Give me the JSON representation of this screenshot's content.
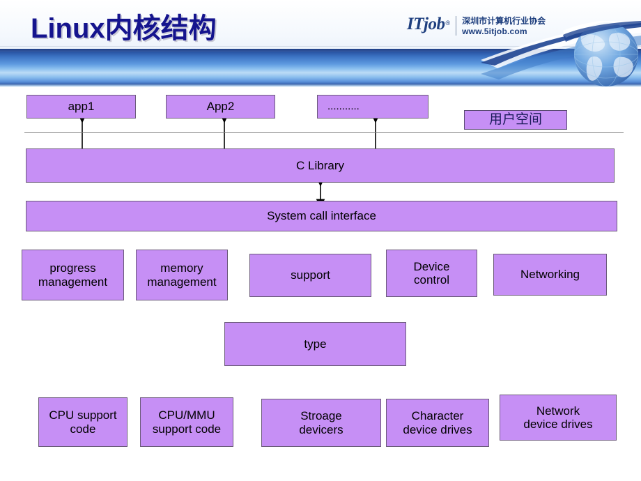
{
  "header": {
    "title": "Linux内核结构",
    "brand": {
      "name": "ITjob",
      "registered": "®",
      "association": "深圳市计算机行业协会",
      "url": "www.5itjob.com"
    }
  },
  "colors": {
    "box_fill": "#C68FF5",
    "box_border": "#6B5A7A",
    "title": "#15148E",
    "brand": "#1B3C7C",
    "divider": "#808080",
    "arrow": "#000000"
  },
  "diagram": {
    "title": "Linux kernel structure layers",
    "user_space_label": "用户空间",
    "row_apps": [
      {
        "label": "app1"
      },
      {
        "label": "App2"
      },
      {
        "label": "..........."
      }
    ],
    "row_library": {
      "label": "C Library"
    },
    "row_syscall": {
      "label": "System call interface"
    },
    "row_subsystems": [
      {
        "label": "progress\nmanagement"
      },
      {
        "label": "memory\nmanagement"
      },
      {
        "label": "support"
      },
      {
        "label": "Device\ncontrol"
      },
      {
        "label": "Networking"
      }
    ],
    "row_type": {
      "label": "type"
    },
    "row_drivers": [
      {
        "label": "CPU support\ncode"
      },
      {
        "label": "CPU/MMU\nsupport code"
      },
      {
        "label": "Stroage\ndevicers"
      },
      {
        "label": "Character\ndevice drives"
      },
      {
        "label": "Network\ndevice drives"
      }
    ]
  }
}
